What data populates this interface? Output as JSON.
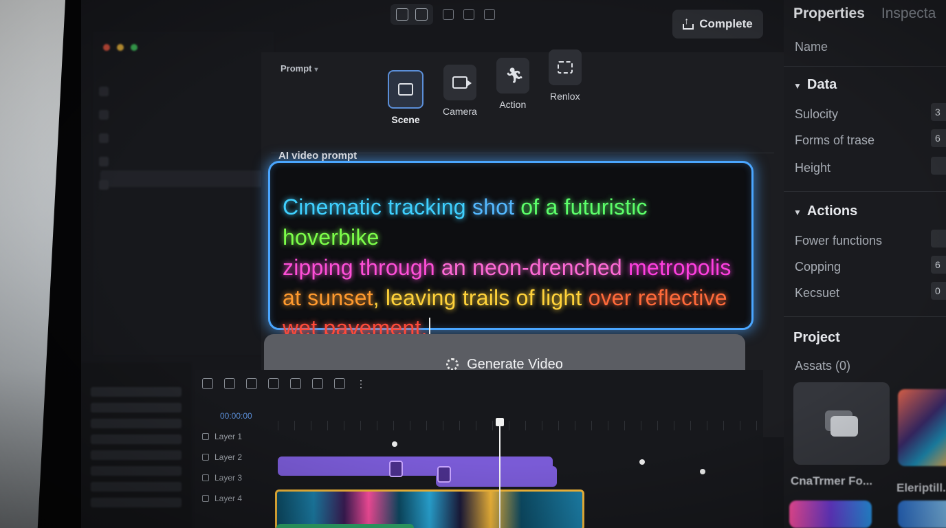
{
  "toolbar": {
    "complete_label": "Complete"
  },
  "prompt_panel": {
    "header": "Prompt",
    "modes": [
      {
        "label": "Scene",
        "icon": "clapperboard-icon",
        "active": true
      },
      {
        "label": "Camera",
        "icon": "camera-icon",
        "active": false
      },
      {
        "label": "Action",
        "icon": "running-icon",
        "active": false
      },
      {
        "label": "Renlox",
        "icon": "expand-icon",
        "active": false
      }
    ],
    "ai_label": "AI video prompt",
    "prompt_words": [
      {
        "text": "Cinematic tracking",
        "color": "#3fd0ff"
      },
      {
        "text": "shot",
        "color": "#54b8ff"
      },
      {
        "text": "of a futuristic",
        "color": "#5cff6a"
      },
      {
        "text": "hoverbike",
        "color": "#7dff4a"
      },
      {
        "text": "zipping through",
        "color": "#ff4fd8"
      },
      {
        "text": "an neon-drenched",
        "color": "#ff6ad6"
      },
      {
        "text": "metropolis",
        "color": "#ff3fe0"
      },
      {
        "text": "at sunset",
        "color": "#ff9a2e"
      },
      {
        "text": ", leaving trails of light",
        "color": "#ffd23a"
      },
      {
        "text": "over reflective",
        "color": "#ff6a3a"
      },
      {
        "text": "wet pavement.",
        "color": "#ff4a3a"
      }
    ],
    "generate_label": "Generate Video"
  },
  "properties": {
    "tab_active": "Properties",
    "tab_inactive": "Inspecta",
    "name_label": "Name",
    "data_section": "Data",
    "data_rows": [
      "Sulocity",
      "Forms of trase",
      "Height"
    ],
    "data_values": [
      "3",
      "6",
      ""
    ],
    "actions_section": "Actions",
    "action_rows": [
      "Fower functions",
      "Copping",
      "Kecsuet"
    ],
    "action_values": [
      "",
      "6",
      "0"
    ],
    "project_section": "Project",
    "assets_label": "Assats (0)",
    "asset_captions": [
      "CnaTrmer Fo...",
      "Eleriptill..."
    ]
  },
  "timeline": {
    "timecode": "00:00:00",
    "layers": [
      "Layer 1",
      "Layer 2",
      "Layer 3",
      "Layer 4"
    ]
  },
  "colors": {
    "accent": "#4aa6ff",
    "clip_purple": "#7a5bd6",
    "clip_gold": "#f1b63a",
    "clip_green": "#2ea86a"
  }
}
